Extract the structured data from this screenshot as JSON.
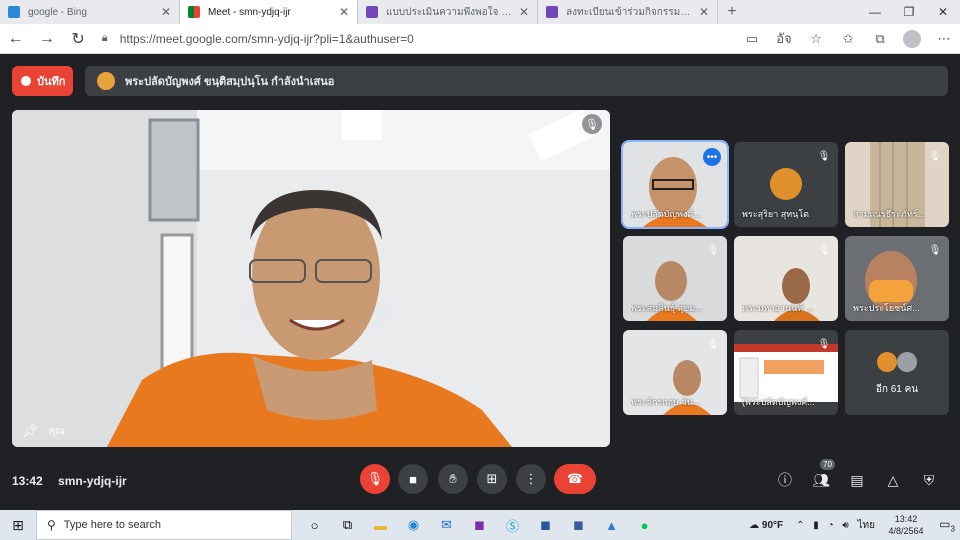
{
  "browser": {
    "tabs": [
      {
        "title": "google - Bing",
        "color": "#2b88d8"
      },
      {
        "title": "Meet - smn-ydjq-ijr",
        "color": "#ea4335"
      },
      {
        "title": "แบบประเมินความพึงพอใจ กิจกรรม พระ",
        "color": "#7248b9"
      },
      {
        "title": "ลงทะเบียนเข้าร่วมกิจกรรม พระสงฆ์ : ห",
        "color": "#7248b9"
      }
    ],
    "new_tab": "+",
    "window_controls": [
      "—",
      "❐",
      "✕"
    ],
    "url": "https://meet.google.com/smn-ydjq-ijr?pli=1&authuser=0",
    "omnibox_icons": [
      "camera-icon",
      "translate-icon",
      "star-icon",
      "favorites-icon",
      "collections-icon",
      "profile-icon",
      "more-icon"
    ],
    "translate_label": "อัจ"
  },
  "meet": {
    "record_label": "บันทึก",
    "presenter_text": "พระปลัดบัญพงศ์ ขนฺติสมฺปนฺโน กำลังนำเสนอ",
    "main_label": "คุณ",
    "tiles": [
      {
        "name": "พระปลัดบัญพงศ์...",
        "active": true
      },
      {
        "name": "พระสุริยา สุทนฺโต",
        "active": false
      },
      {
        "name": "สามเณรธีระภัทร์...",
        "active": false
      },
      {
        "name": "พระสมสินธุ์ สุขุม...",
        "active": false
      },
      {
        "name": "พระมหาอานนท์ ...",
        "active": false
      },
      {
        "name": "พระประโยชน์ศ...",
        "active": false
      },
      {
        "name": "พระจักรกฤษ จัน...",
        "active": false
      },
      {
        "name": "(พระปลัดบัญพงศ์...",
        "active": false
      }
    ],
    "more_people": "อีก 61 คน",
    "time": "13:42",
    "meeting_code": "smn-ydjq-ijr",
    "participant_count": "70",
    "accent": "#8ab4f8",
    "danger": "#ea4335"
  },
  "taskbar": {
    "search_placeholder": "Type here to search",
    "weather": "90°F",
    "lang": "ไทย",
    "clock_time": "13:42",
    "clock_date": "4/8/2564",
    "notifications": "3"
  }
}
